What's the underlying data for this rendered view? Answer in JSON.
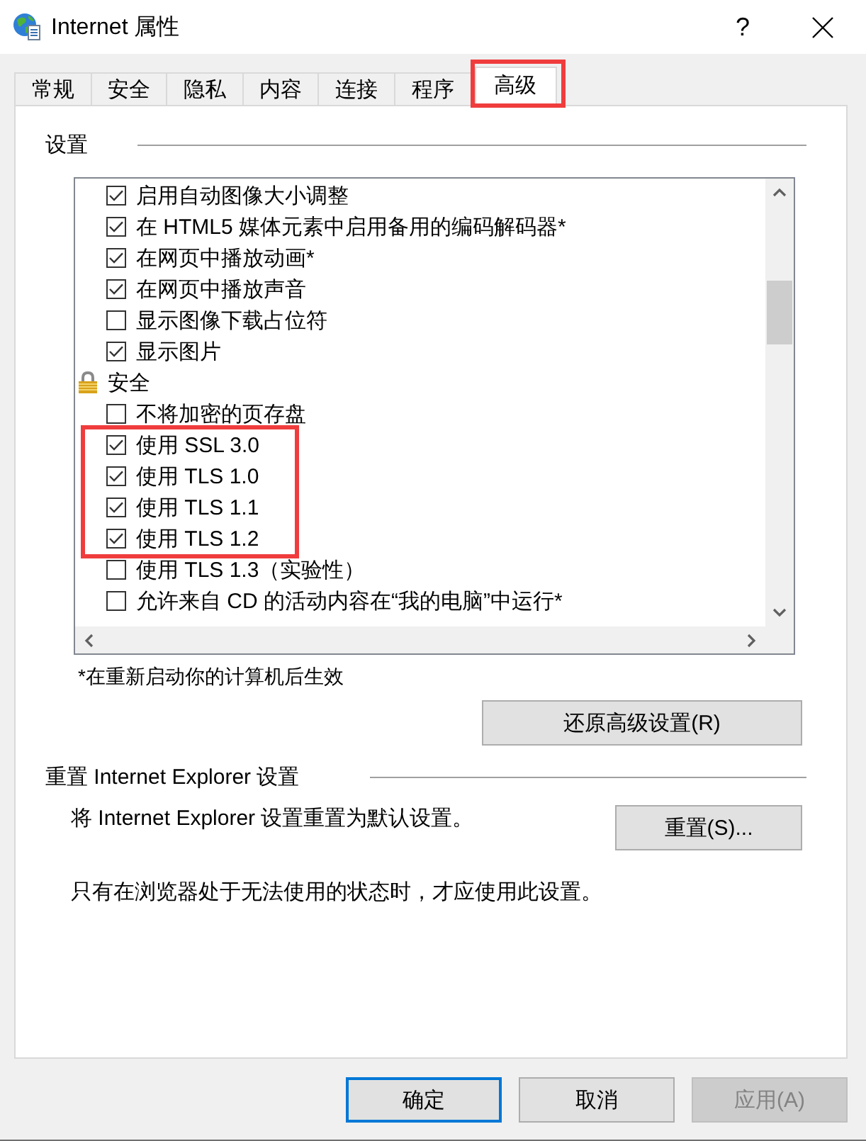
{
  "window": {
    "title": "Internet 属性",
    "help": "?"
  },
  "tabs": [
    {
      "label": "常规",
      "selected": false,
      "highlighted": false
    },
    {
      "label": "安全",
      "selected": false,
      "highlighted": false
    },
    {
      "label": "隐私",
      "selected": false,
      "highlighted": false
    },
    {
      "label": "内容",
      "selected": false,
      "highlighted": false
    },
    {
      "label": "连接",
      "selected": false,
      "highlighted": false
    },
    {
      "label": "程序",
      "selected": false,
      "highlighted": false
    },
    {
      "label": "高级",
      "selected": true,
      "highlighted": true
    }
  ],
  "settings": {
    "title": "设置",
    "categories": [
      {
        "children": [
          {
            "label": "启用自动图像大小调整",
            "checked": true,
            "highlighted": false
          },
          {
            "label": "在 HTML5 媒体元素中启用备用的编码解码器*",
            "checked": true,
            "highlighted": false
          },
          {
            "label": "在网页中播放动画*",
            "checked": true,
            "highlighted": false
          },
          {
            "label": "在网页中播放声音",
            "checked": true,
            "highlighted": false
          },
          {
            "label": "显示图像下载占位符",
            "checked": false,
            "highlighted": false
          },
          {
            "label": "显示图片",
            "checked": true,
            "highlighted": false
          }
        ]
      },
      {
        "label": "安全",
        "children": [
          {
            "label": "不将加密的页存盘",
            "checked": false,
            "highlighted": false
          },
          {
            "label": "使用 SSL 3.0",
            "checked": true,
            "highlighted": true
          },
          {
            "label": "使用 TLS 1.0",
            "checked": true,
            "highlighted": true
          },
          {
            "label": "使用 TLS 1.1",
            "checked": true,
            "highlighted": true
          },
          {
            "label": "使用 TLS 1.2",
            "checked": true,
            "highlighted": true
          },
          {
            "label": "使用 TLS 1.3（实验性）",
            "checked": false,
            "highlighted": false
          },
          {
            "label": "允许来自 CD 的活动内容在“我的电脑”中运行*",
            "checked": false,
            "highlighted": false
          }
        ]
      }
    ],
    "note": "*在重新启动你的计算机后生效",
    "restore_button": "还原高级设置(R)"
  },
  "reset": {
    "title": "重置 Internet Explorer 设置",
    "description": "将 Internet Explorer 设置重置为默认设置。",
    "button": "重置(S)...",
    "warning": "只有在浏览器处于无法使用的状态时，才应使用此设置。"
  },
  "buttons": [
    {
      "label": "确定",
      "kind": "default",
      "disabled": false
    },
    {
      "label": "取消",
      "kind": "normal",
      "disabled": false
    },
    {
      "label": "应用(A)",
      "kind": "normal",
      "disabled": true
    }
  ]
}
